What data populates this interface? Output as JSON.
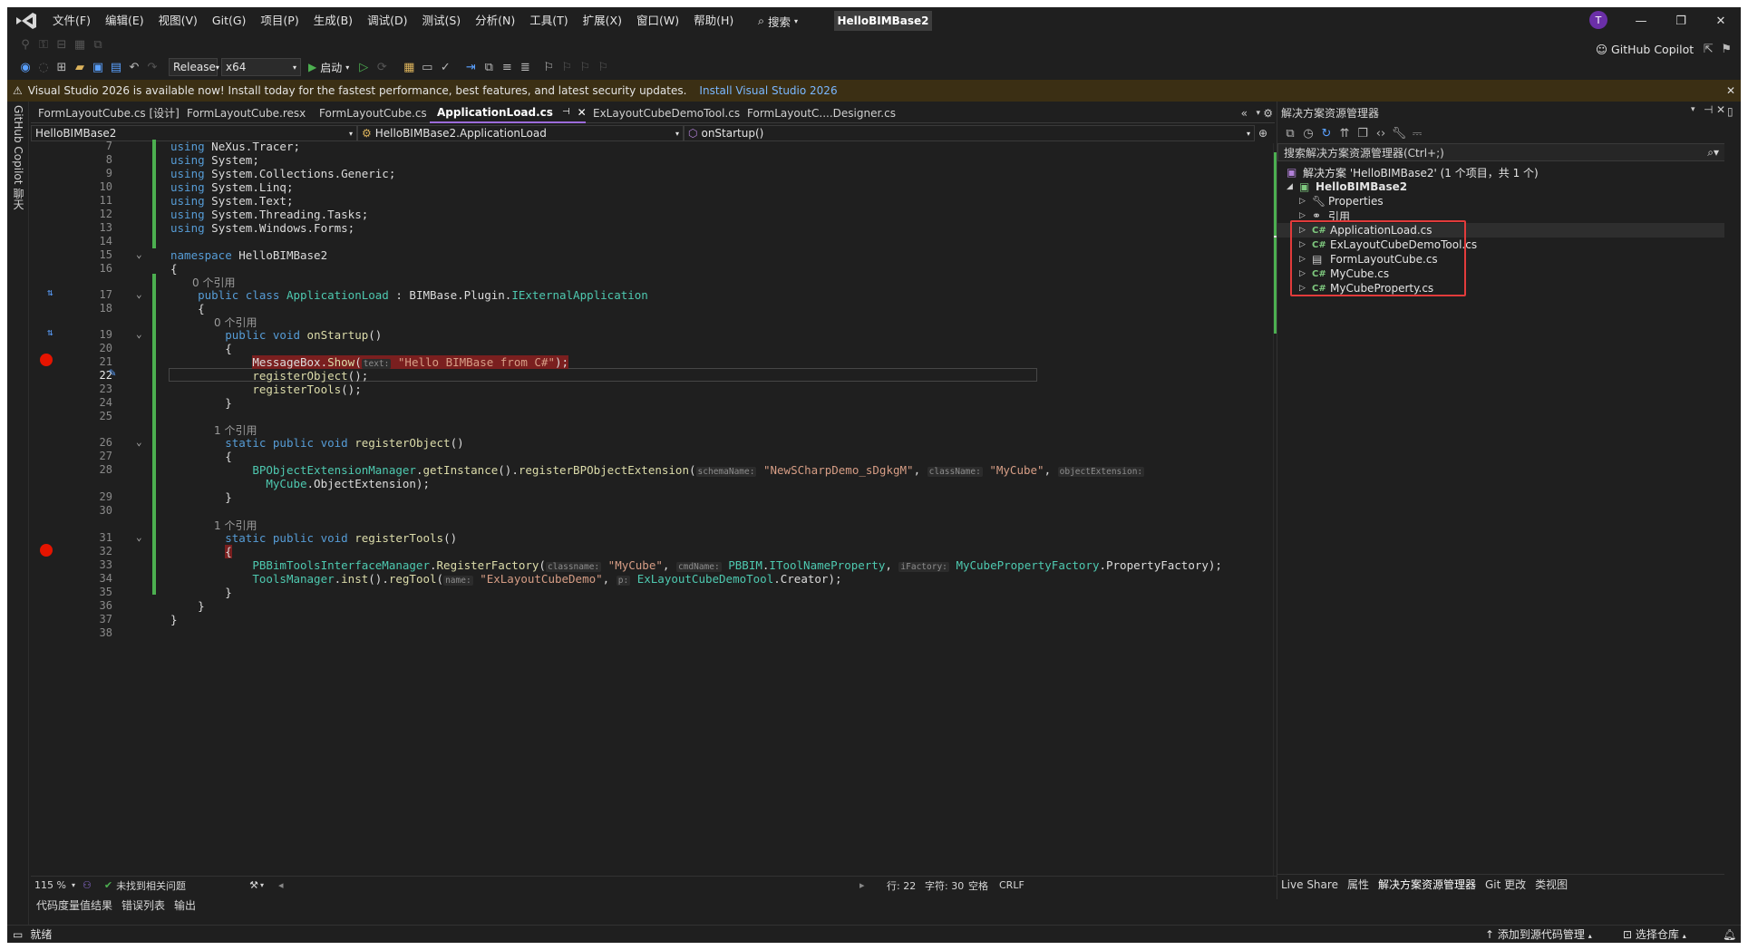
{
  "titlebar": {
    "menu": [
      "文件(F)",
      "编辑(E)",
      "视图(V)",
      "Git(G)",
      "项目(P)",
      "生成(B)",
      "调试(D)",
      "测试(S)",
      "分析(N)",
      "工具(T)",
      "扩展(X)",
      "窗口(W)",
      "帮助(H)"
    ],
    "search": "搜索",
    "solution_name": "HelloBIMBase2",
    "avatar": "T",
    "minimize": "—",
    "maximize": "❐",
    "close": "✕"
  },
  "toolbar": {
    "config": "Release",
    "platform": "x64",
    "start": "启动",
    "copilot": "GitHub Copilot"
  },
  "banner": {
    "text": "Visual Studio 2026 is available now! Install today for the fastest performance, best features, and latest security updates.",
    "link": "Install Visual Studio 2026"
  },
  "leftstrip": {
    "label": "GitHub Copilot 聊天"
  },
  "tabs": [
    {
      "label": "FormLayoutCube.cs [设计]"
    },
    {
      "label": "FormLayoutCube.resx"
    },
    {
      "label": "FormLayoutCube.cs"
    },
    {
      "label": "ApplicationLoad.cs"
    },
    {
      "label": "ExLayoutCubeDemoTool.cs"
    },
    {
      "label": "FormLayoutC....Designer.cs"
    }
  ],
  "navbar": {
    "project": "HelloBIMBase2",
    "class": "HelloBIMBase2.ApplicationLoad",
    "member": "onStartup()"
  },
  "editor": {
    "refs_0": "0 个引用",
    "refs_1": "1 个引用",
    "line_numbers": [
      "7",
      "8",
      "9",
      "10",
      "11",
      "12",
      "13",
      "14",
      "15",
      "16",
      "17",
      "18",
      "19",
      "20",
      "21",
      "22",
      "23",
      "24",
      "25",
      "26",
      "27",
      "28",
      "29",
      "30",
      "31",
      "32",
      "33",
      "34",
      "35",
      "36",
      "37",
      "38"
    ]
  },
  "status": {
    "zoom": "115 %",
    "issues": "未找到相关问题",
    "line": "行: 22",
    "char": "字符: 30",
    "spaces": "空格",
    "eol": "CRLF"
  },
  "output_tabs": [
    "代码度量值结果",
    "错误列表",
    "输出"
  ],
  "statusbar": {
    "ready": "就绪",
    "add_source": "添加到源代码管理",
    "select_repo": "选择仓库"
  },
  "solution_explorer": {
    "title": "解决方案资源管理器",
    "search_placeholder": "搜索解决方案资源管理器(Ctrl+;)",
    "solution": "解决方案 'HelloBIMBase2' (1 个项目，共 1 个)",
    "project": "HelloBIMBase2",
    "properties": "Properties",
    "references": "引用",
    "files": [
      "ApplicationLoad.cs",
      "ExLayoutCubeDemoTool.cs",
      "FormLayoutCube.cs",
      "MyCube.cs",
      "MyCubeProperty.cs"
    ],
    "bottom_tabs": [
      "Live Share",
      "属性",
      "解决方案资源管理器",
      "Git 更改",
      "类视图"
    ]
  }
}
